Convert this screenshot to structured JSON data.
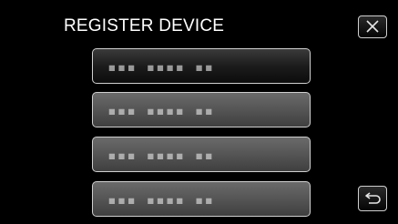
{
  "screen": {
    "title": "REGISTER DEVICE"
  },
  "buttons": {
    "close_icon": "close-icon",
    "back_icon": "return-arrow-icon"
  },
  "slots": [
    {
      "id_text": "▪▪▪ ▪▪▪▪ ▪▪",
      "state": "selected"
    },
    {
      "id_text": "▪▪▪ ▪▪▪▪ ▪▪",
      "state": "idle"
    },
    {
      "id_text": "▪▪▪ ▪▪▪▪ ▪▪",
      "state": "idle"
    },
    {
      "id_text": "▪▪▪ ▪▪▪▪ ▪▪",
      "state": "idle"
    }
  ],
  "colors": {
    "background": "#000000",
    "text": "#ffffff",
    "slot_border": "#cfcfcf"
  }
}
